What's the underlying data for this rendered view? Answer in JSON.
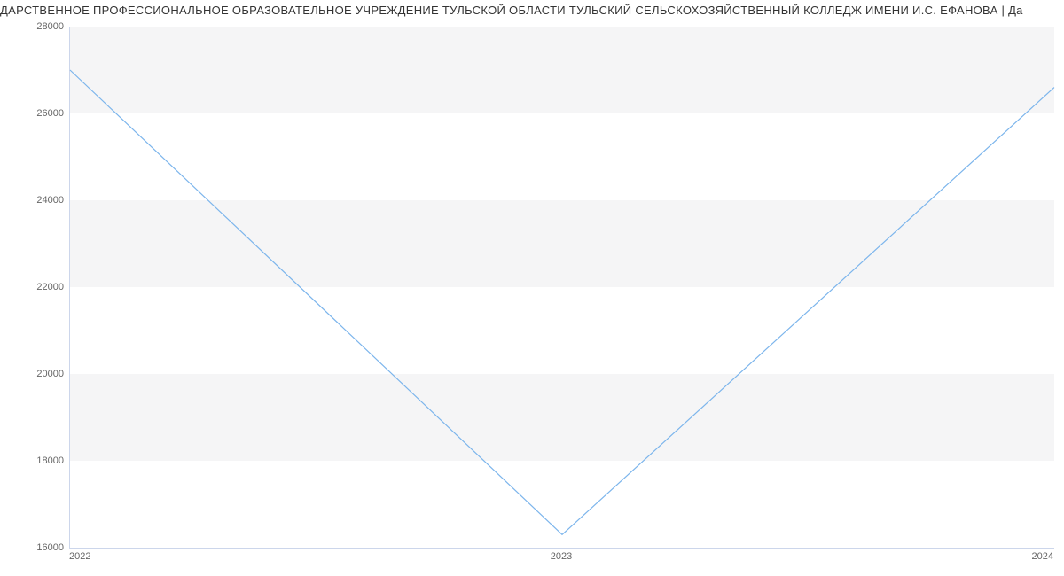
{
  "chart_data": {
    "type": "line",
    "title": "ДАРСТВЕННОЕ ПРОФЕССИОНАЛЬНОЕ ОБРАЗОВАТЕЛЬНОЕ УЧРЕЖДЕНИЕ ТУЛЬСКОЙ ОБЛАСТИ ТУЛЬСКИЙ СЕЛЬСКОХОЗЯЙСТВЕННЫЙ КОЛЛЕДЖ ИМЕНИ И.С. ЕФАНОВА | Да",
    "x": [
      2022,
      2023,
      2024
    ],
    "values": [
      27000,
      16300,
      26600
    ],
    "xlim": [
      2022,
      2024
    ],
    "ylim": [
      16000,
      28000
    ],
    "y_ticks": [
      16000,
      18000,
      20000,
      22000,
      24000,
      26000,
      28000
    ],
    "x_ticks": [
      2022,
      2023,
      2024
    ],
    "xlabel": "",
    "ylabel": ""
  }
}
